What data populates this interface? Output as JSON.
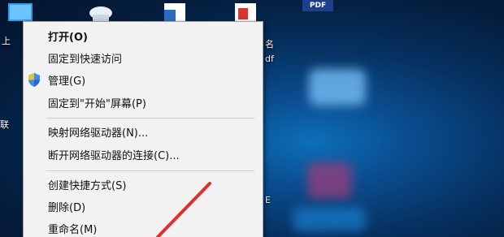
{
  "desktop": {
    "labels": [
      {
        "id": "left-1",
        "text": "上"
      },
      {
        "id": "left-2",
        "text": "联"
      },
      {
        "id": "right-1",
        "text": "名"
      },
      {
        "id": "right-2",
        "text": "df"
      },
      {
        "id": "right-3",
        "text": "E"
      }
    ],
    "icon_badge": "PDF"
  },
  "context_menu": {
    "items": [
      {
        "label": "打开(O)",
        "bold": true
      },
      {
        "label": "固定到快速访问"
      },
      {
        "label": "管理(G)",
        "icon": "uac-shield-icon"
      },
      {
        "label": "固定到\"开始\"屏幕(P)"
      },
      {
        "label": "映射网络驱动器(N)..."
      },
      {
        "label": "断开网络驱动器的连接(C)..."
      },
      {
        "label": "创建快捷方式(S)"
      },
      {
        "label": "删除(D)"
      },
      {
        "label": "重命名(M)"
      }
    ]
  },
  "colors": {
    "menu_bg": "#f2f2f2",
    "annotation_arrow": "#e0302a",
    "desktop_bg": "#0a4d8f"
  }
}
